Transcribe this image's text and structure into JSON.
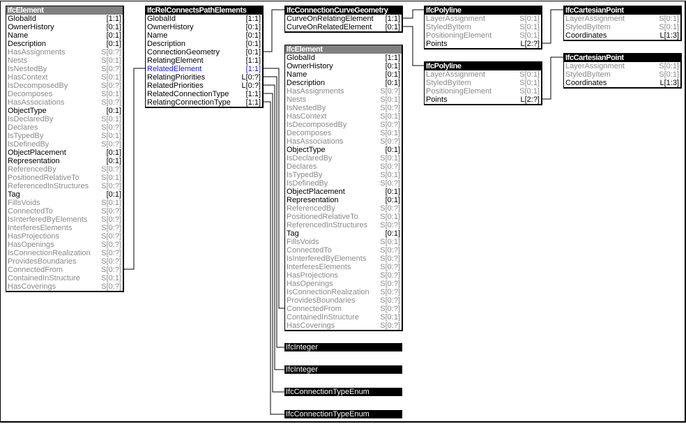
{
  "entities": {
    "ifc_element_left": {
      "title": "IfcElement",
      "header_style": "gray",
      "attributes": [
        {
          "name": "GlobalId",
          "card": "[1:1]",
          "kind": "req"
        },
        {
          "name": "OwnerHistory",
          "card": "[0:1]",
          "kind": "req"
        },
        {
          "name": "Name",
          "card": "[0:1]",
          "kind": "req"
        },
        {
          "name": "Description",
          "card": "[0:1]",
          "kind": "req"
        },
        {
          "name": "HasAssignments",
          "card": "S[0:?]",
          "kind": "inv"
        },
        {
          "name": "Nests",
          "card": "S[0:1]",
          "kind": "inv"
        },
        {
          "name": "IsNestedBy",
          "card": "S[0:?]",
          "kind": "inv"
        },
        {
          "name": "HasContext",
          "card": "S[0:1]",
          "kind": "inv"
        },
        {
          "name": "IsDecomposedBy",
          "card": "S[0:?]",
          "kind": "inv"
        },
        {
          "name": "Decomposes",
          "card": "S[0:1]",
          "kind": "inv"
        },
        {
          "name": "HasAssociations",
          "card": "S[0:?]",
          "kind": "inv"
        },
        {
          "name": "ObjectType",
          "card": "[0:1]",
          "kind": "req"
        },
        {
          "name": "IsDeclaredBy",
          "card": "S[0:1]",
          "kind": "inv"
        },
        {
          "name": "Declares",
          "card": "S[0:?]",
          "kind": "inv"
        },
        {
          "name": "IsTypedBy",
          "card": "S[0:1]",
          "kind": "inv"
        },
        {
          "name": "IsDefinedBy",
          "card": "S[0:?]",
          "kind": "inv"
        },
        {
          "name": "ObjectPlacement",
          "card": "[0:1]",
          "kind": "req"
        },
        {
          "name": "Representation",
          "card": "[0:1]",
          "kind": "req"
        },
        {
          "name": "ReferencedBy",
          "card": "S[0:?]",
          "kind": "inv"
        },
        {
          "name": "PositionedRelativeTo",
          "card": "S[0:1]",
          "kind": "inv"
        },
        {
          "name": "ReferencedInStructures",
          "card": "S[0:?]",
          "kind": "inv"
        },
        {
          "name": "Tag",
          "card": "[0:1]",
          "kind": "req"
        },
        {
          "name": "FillsVoids",
          "card": "S[0:1]",
          "kind": "inv"
        },
        {
          "name": "ConnectedTo",
          "card": "S[0:?]",
          "kind": "inv"
        },
        {
          "name": "IsInterferedByElements",
          "card": "S[0:?]",
          "kind": "inv"
        },
        {
          "name": "InterferesElements",
          "card": "S[0:?]",
          "kind": "inv"
        },
        {
          "name": "HasProjections",
          "card": "S[0:?]",
          "kind": "inv"
        },
        {
          "name": "HasOpenings",
          "card": "S[0:?]",
          "kind": "inv"
        },
        {
          "name": "IsConnectionRealization",
          "card": "S[0:?]",
          "kind": "inv"
        },
        {
          "name": "ProvidesBoundaries",
          "card": "S[0:?]",
          "kind": "inv"
        },
        {
          "name": "ConnectedFrom",
          "card": "S[0:?]",
          "kind": "inv"
        },
        {
          "name": "ContainedInStructure",
          "card": "S[0:1]",
          "kind": "inv"
        },
        {
          "name": "HasCoverings",
          "card": "S[0:?]",
          "kind": "inv"
        }
      ]
    },
    "ifc_rel_connects_path_elements": {
      "title": "IfcRelConnectsPathElements",
      "header_style": "dark",
      "attributes": [
        {
          "name": "GlobalId",
          "card": "[1:1]",
          "kind": "req"
        },
        {
          "name": "OwnerHistory",
          "card": "[0:1]",
          "kind": "req"
        },
        {
          "name": "Name",
          "card": "[0:1]",
          "kind": "req"
        },
        {
          "name": "Description",
          "card": "[0:1]",
          "kind": "req"
        },
        {
          "name": "ConnectionGeometry",
          "card": "[0:1]",
          "kind": "req"
        },
        {
          "name": "RelatingElement",
          "card": "[1:1]",
          "kind": "req"
        },
        {
          "name": "RelatedElement",
          "card": "[1:1]",
          "kind": "sel"
        },
        {
          "name": "RelatingPriorities",
          "card": "L[0:?]",
          "kind": "req"
        },
        {
          "name": "RelatedPriorities",
          "card": "L[0:?]",
          "kind": "req"
        },
        {
          "name": "RelatedConnectionType",
          "card": "[1:1]",
          "kind": "req"
        },
        {
          "name": "RelatingConnectionType",
          "card": "[1:1]",
          "kind": "req"
        }
      ]
    },
    "ifc_connection_curve_geometry": {
      "title": "IfcConnectionCurveGeometry",
      "header_style": "dark",
      "attributes": [
        {
          "name": "CurveOnRelatingElement",
          "card": "[1:1]",
          "kind": "req"
        },
        {
          "name": "CurveOnRelatedElement",
          "card": "[0:1]",
          "kind": "req"
        }
      ]
    },
    "ifc_element_right": {
      "title": "IfcElement",
      "header_style": "gray",
      "attributes": [
        {
          "name": "GlobalId",
          "card": "[1:1]",
          "kind": "req"
        },
        {
          "name": "OwnerHistory",
          "card": "[0:1]",
          "kind": "req"
        },
        {
          "name": "Name",
          "card": "[0:1]",
          "kind": "req"
        },
        {
          "name": "Description",
          "card": "[0:1]",
          "kind": "req"
        },
        {
          "name": "HasAssignments",
          "card": "S[0:?]",
          "kind": "inv"
        },
        {
          "name": "Nests",
          "card": "S[0:1]",
          "kind": "inv"
        },
        {
          "name": "IsNestedBy",
          "card": "S[0:?]",
          "kind": "inv"
        },
        {
          "name": "HasContext",
          "card": "S[0:1]",
          "kind": "inv"
        },
        {
          "name": "IsDecomposedBy",
          "card": "S[0:?]",
          "kind": "inv"
        },
        {
          "name": "Decomposes",
          "card": "S[0:1]",
          "kind": "inv"
        },
        {
          "name": "HasAssociations",
          "card": "S[0:?]",
          "kind": "inv"
        },
        {
          "name": "ObjectType",
          "card": "[0:1]",
          "kind": "req"
        },
        {
          "name": "IsDeclaredBy",
          "card": "S[0:1]",
          "kind": "inv"
        },
        {
          "name": "Declares",
          "card": "S[0:?]",
          "kind": "inv"
        },
        {
          "name": "IsTypedBy",
          "card": "S[0:1]",
          "kind": "inv"
        },
        {
          "name": "IsDefinedBy",
          "card": "S[0:?]",
          "kind": "inv"
        },
        {
          "name": "ObjectPlacement",
          "card": "[0:1]",
          "kind": "req"
        },
        {
          "name": "Representation",
          "card": "[0:1]",
          "kind": "req"
        },
        {
          "name": "ReferencedBy",
          "card": "S[0:?]",
          "kind": "inv"
        },
        {
          "name": "PositionedRelativeTo",
          "card": "S[0:1]",
          "kind": "inv"
        },
        {
          "name": "ReferencedInStructures",
          "card": "S[0:?]",
          "kind": "inv"
        },
        {
          "name": "Tag",
          "card": "[0:1]",
          "kind": "req"
        },
        {
          "name": "FillsVoids",
          "card": "S[0:1]",
          "kind": "inv"
        },
        {
          "name": "ConnectedTo",
          "card": "S[0:?]",
          "kind": "inv"
        },
        {
          "name": "IsInterferedByElements",
          "card": "S[0:?]",
          "kind": "inv"
        },
        {
          "name": "InterferesElements",
          "card": "S[0:?]",
          "kind": "inv"
        },
        {
          "name": "HasProjections",
          "card": "S[0:?]",
          "kind": "inv"
        },
        {
          "name": "HasOpenings",
          "card": "S[0:?]",
          "kind": "inv"
        },
        {
          "name": "IsConnectionRealization",
          "card": "S[0:?]",
          "kind": "inv"
        },
        {
          "name": "ProvidesBoundaries",
          "card": "S[0:?]",
          "kind": "inv"
        },
        {
          "name": "ConnectedFrom",
          "card": "S[0:?]",
          "kind": "inv"
        },
        {
          "name": "ContainedInStructure",
          "card": "S[0:1]",
          "kind": "inv"
        },
        {
          "name": "HasCoverings",
          "card": "S[0:?]",
          "kind": "inv"
        }
      ]
    },
    "ifc_polyline_1": {
      "title": "IfcPolyline",
      "header_style": "dark",
      "attributes": [
        {
          "name": "LayerAssignment",
          "card": "S[0:1]",
          "kind": "inv"
        },
        {
          "name": "StyledByItem",
          "card": "S[0:1]",
          "kind": "inv"
        },
        {
          "name": "PositioningElement",
          "card": "S[0:1]",
          "kind": "inv"
        },
        {
          "name": "Points",
          "card": "L[2:?]",
          "kind": "req"
        }
      ]
    },
    "ifc_polyline_2": {
      "title": "IfcPolyline",
      "header_style": "dark",
      "attributes": [
        {
          "name": "LayerAssignment",
          "card": "S[0:1]",
          "kind": "inv"
        },
        {
          "name": "StyledByItem",
          "card": "S[0:1]",
          "kind": "inv"
        },
        {
          "name": "PositioningElement",
          "card": "S[0:1]",
          "kind": "inv"
        },
        {
          "name": "Points",
          "card": "L[2:?]",
          "kind": "req"
        }
      ]
    },
    "ifc_cartesian_point_1": {
      "title": "IfcCartesianPoint",
      "header_style": "dark",
      "attributes": [
        {
          "name": "LayerAssignment",
          "card": "S[0:1]",
          "kind": "inv"
        },
        {
          "name": "StyledByItem",
          "card": "S[0:1]",
          "kind": "inv"
        },
        {
          "name": "Coordinates",
          "card": "L[1:3]",
          "kind": "req"
        }
      ]
    },
    "ifc_cartesian_point_2": {
      "title": "IfcCartesianPoint",
      "header_style": "dark",
      "attributes": [
        {
          "name": "LayerAssignment",
          "card": "S[0:1]",
          "kind": "inv"
        },
        {
          "name": "StyledByItem",
          "card": "S[0:1]",
          "kind": "inv"
        },
        {
          "name": "Coordinates",
          "card": "L[1:3]",
          "kind": "req"
        }
      ]
    }
  },
  "types": {
    "ifc_integer_1": "IfcInteger",
    "ifc_integer_2": "IfcInteger",
    "ifc_connection_type_enum_1": "IfcConnectionTypeEnum",
    "ifc_connection_type_enum_2": "IfcConnectionTypeEnum"
  },
  "colors": {
    "required_text": "#000000",
    "inverse_text": "#8a8a8a",
    "selected_text": "#1a1adb",
    "header_dark": "#000000",
    "header_gray": "#808080"
  }
}
